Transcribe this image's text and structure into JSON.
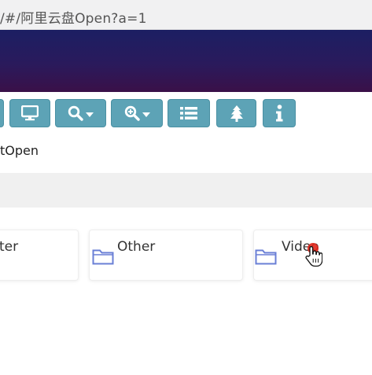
{
  "browser": {
    "url": "/#/阿里云盘Open?a=1"
  },
  "toolbar": {
    "buttons": [
      {
        "name": "partial-button",
        "icon": "blank"
      },
      {
        "name": "display-button",
        "icon": "monitor-icon"
      },
      {
        "name": "search-dropdown-button",
        "icon": "search-icon"
      },
      {
        "name": "zoom-dropdown-button",
        "icon": "zoom-in-icon"
      },
      {
        "name": "list-view-button",
        "icon": "list-icon"
      },
      {
        "name": "tree-view-button",
        "icon": "tree-icon"
      },
      {
        "name": "info-button",
        "icon": "info-icon"
      }
    ]
  },
  "breadcrumb": {
    "path": "tOpen"
  },
  "folders": [
    {
      "label": "ter"
    },
    {
      "label": "Other"
    },
    {
      "label": "Video"
    }
  ],
  "colors": {
    "button": "#5da3b6",
    "banner_top": "#1c1f63",
    "banner_bottom": "#3a1048",
    "folder_icon": "#6a7fd6"
  }
}
